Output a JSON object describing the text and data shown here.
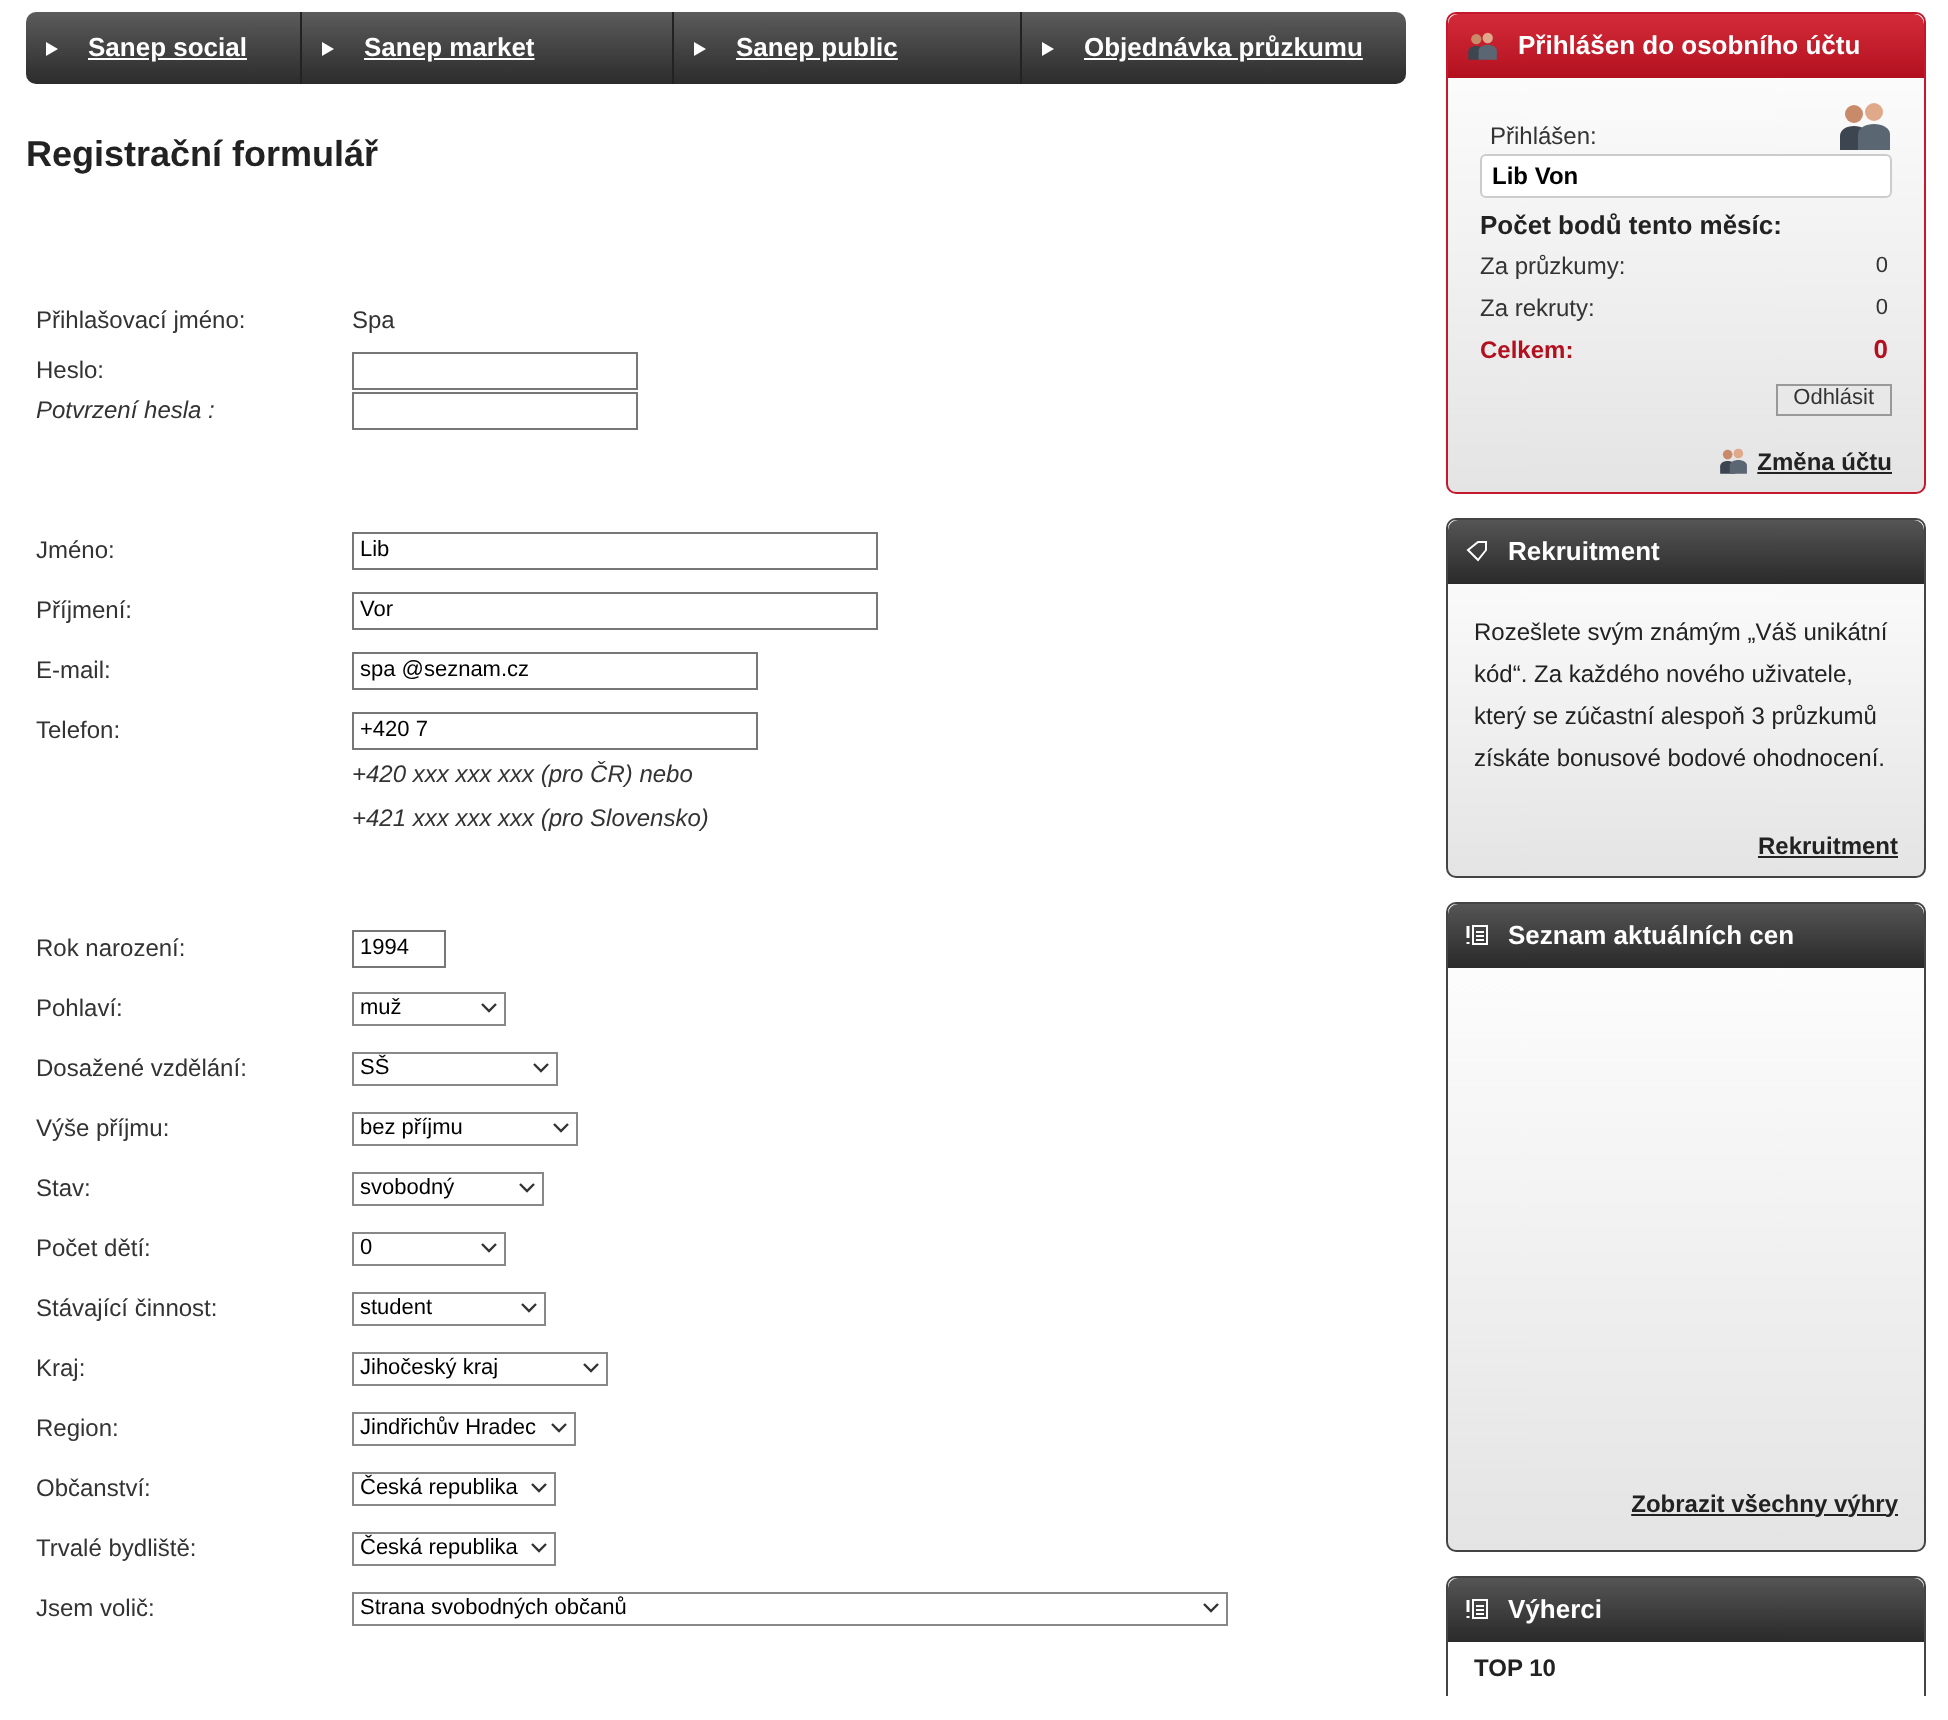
{
  "nav": [
    {
      "label": "Sanep social"
    },
    {
      "label": "Sanep market"
    },
    {
      "label": "Sanep public"
    },
    {
      "label": "Objednávka průzkumu"
    }
  ],
  "heading": "Registrační formulář",
  "form_groups": [
    [
      {
        "label": "Přihlašovací jméno:",
        "kind": "text",
        "value": "Spa"
      },
      {
        "label": "Heslo:",
        "kind": "password"
      },
      {
        "label": "Potvrzení hesla :",
        "kind": "password",
        "italic": true
      }
    ],
    [
      {
        "label": "Jméno:",
        "kind": "input",
        "value": "Lib"
      },
      {
        "label": "Příjmení:",
        "kind": "input",
        "value": "Vor"
      },
      {
        "label": "E-mail:",
        "kind": "input",
        "value": "spa @seznam.cz"
      },
      {
        "label": "Telefon:",
        "kind": "input",
        "value": "+420 7",
        "hints": [
          "+420 xxx xxx xxx (pro ČR) nebo",
          "+421 xxx xxx xxx (pro Slovensko)"
        ]
      }
    ],
    [
      {
        "label": "Rok narození:",
        "kind": "input",
        "value": "1994"
      },
      {
        "label": "Pohlaví:",
        "kind": "select",
        "value": "muž"
      },
      {
        "label": "Dosažené vzdělání:",
        "kind": "select",
        "value": "SŠ"
      },
      {
        "label": "Výše příjmu:",
        "kind": "select",
        "value": "bez příjmu"
      },
      {
        "label": "Stav:",
        "kind": "select",
        "value": "svobodný"
      },
      {
        "label": "Počet dětí:",
        "kind": "select",
        "value": "0"
      },
      {
        "label": "Stávající činnost:",
        "kind": "select",
        "value": "student"
      },
      {
        "label": "Kraj:",
        "kind": "select",
        "value": "Jihočeský kraj"
      },
      {
        "label": "Region:",
        "kind": "select",
        "value": "Jindřichův Hradec"
      },
      {
        "label": "Občanství:",
        "kind": "select",
        "value": "Česká republika"
      },
      {
        "label": "Trvalé bydliště:",
        "kind": "select",
        "value": "Česká republika"
      },
      {
        "label": "Jsem volič:",
        "kind": "select",
        "value": "Strana svobodných občanů"
      }
    ]
  ],
  "account_panel": {
    "title": "Přihlášen do osobního účtu",
    "logged_in_label": "Přihlášen:",
    "user": "Lib Von",
    "points_title": "Počet bodů tento měsíc:",
    "points": [
      {
        "label": "Za průzkumy:",
        "value": "0",
        "kind": "normal"
      },
      {
        "label": "Za rekruty:",
        "value": "0",
        "kind": "normal"
      },
      {
        "label": "Celkem:",
        "value": "0",
        "kind": "total"
      }
    ],
    "logout_button": "Odhlásit",
    "switch_link": "Změna účtu"
  },
  "recruit_panel": {
    "title": "Rekruitment",
    "text": "Rozešlete svým známým „Váš unikátní kód“. Za každého nového uživatele, který se zúčastní alespoň 3 průzkumů získáte bonusové bodové ohodnocení.",
    "link": "Rekruitment"
  },
  "prices_panel": {
    "title": "Seznam aktuálních cen",
    "link": "Zobrazit všechny výhry"
  },
  "winners_panel": {
    "title": "Výherci",
    "subtitle": "TOP 10"
  }
}
